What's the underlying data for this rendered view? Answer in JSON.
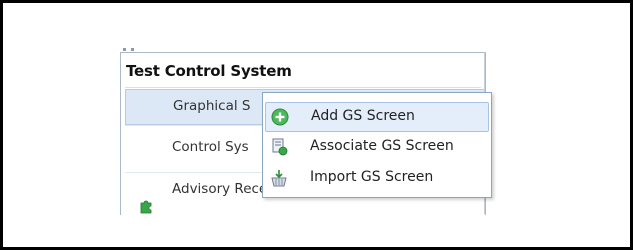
{
  "panel": {
    "title": "Test Control System",
    "items": [
      {
        "label": "Graphical S",
        "icon": "none"
      },
      {
        "label": "Control Sys",
        "icon": "none"
      },
      {
        "label": "Advisory Receiver Commission",
        "icon": "green-puzzle-icon"
      }
    ]
  },
  "context_menu": {
    "items": [
      {
        "label": "Add GS Screen",
        "icon": "green-plus-circle-icon",
        "highlighted": true
      },
      {
        "label": "Associate GS Screen",
        "icon": "document-link-icon",
        "highlighted": false
      },
      {
        "label": "Import GS Screen",
        "icon": "import-basket-icon",
        "highlighted": false
      }
    ]
  },
  "colors": {
    "accent_green": "#3aa64a",
    "selection": "#dde8f6",
    "menu_border": "#8aa6c6"
  }
}
